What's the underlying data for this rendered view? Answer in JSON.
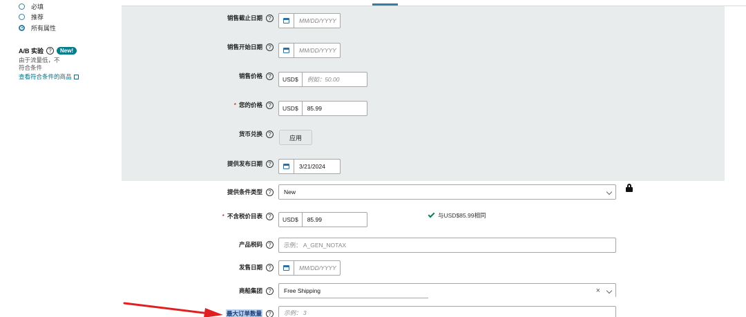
{
  "sidebar": {
    "radio_items": [
      {
        "label": "必填",
        "checked": false
      },
      {
        "label": "推荐",
        "checked": false
      },
      {
        "label": "所有属性",
        "checked": true
      }
    ],
    "ab_title": "A/B 实验",
    "ab_badge": "New!",
    "ab_desc": "由于流量低，不符合条件",
    "ab_link": "查看符合条件的商品"
  },
  "form": {
    "sale_end_date": {
      "label": "销售截止日期",
      "placeholder": "MM/DD/YYYY"
    },
    "sale_start_date": {
      "label": "销售开始日期",
      "placeholder": "MM/DD/YYYY"
    },
    "sale_price": {
      "label": "销售价格",
      "prefix": "USD$",
      "placeholder": "例如：50.00"
    },
    "your_price": {
      "label": "您的价格",
      "prefix": "USD$",
      "value": "85.99"
    },
    "currency_convert": {
      "label": "货币兑换",
      "button": "应用"
    },
    "offer_release_date": {
      "label": "提供发布日期",
      "value": "3/21/2024"
    },
    "offer_condition_type": {
      "label": "提供条件类型",
      "value": "New"
    },
    "price_excl_tax": {
      "label": "不含税价目表",
      "prefix": "USD$",
      "value": "85.99",
      "match_note": "与USD$85.99相同"
    },
    "product_tax_code": {
      "label": "产品税码",
      "placeholder": "示例：  A_GEN_NOTAX"
    },
    "ship_date": {
      "label": "发售日期",
      "placeholder": "MM/DD/YYYY"
    },
    "shipping_group": {
      "label": "商船集团",
      "value": "Free Shipping",
      "clear": "×"
    },
    "max_order_qty": {
      "label": "最大订单数量",
      "placeholder": "示例：  3"
    },
    "help_glyph": "?"
  },
  "colors": {
    "accent": "#2e7fa3",
    "arrow": "#e02020",
    "section_gray": "#e9ecec"
  }
}
